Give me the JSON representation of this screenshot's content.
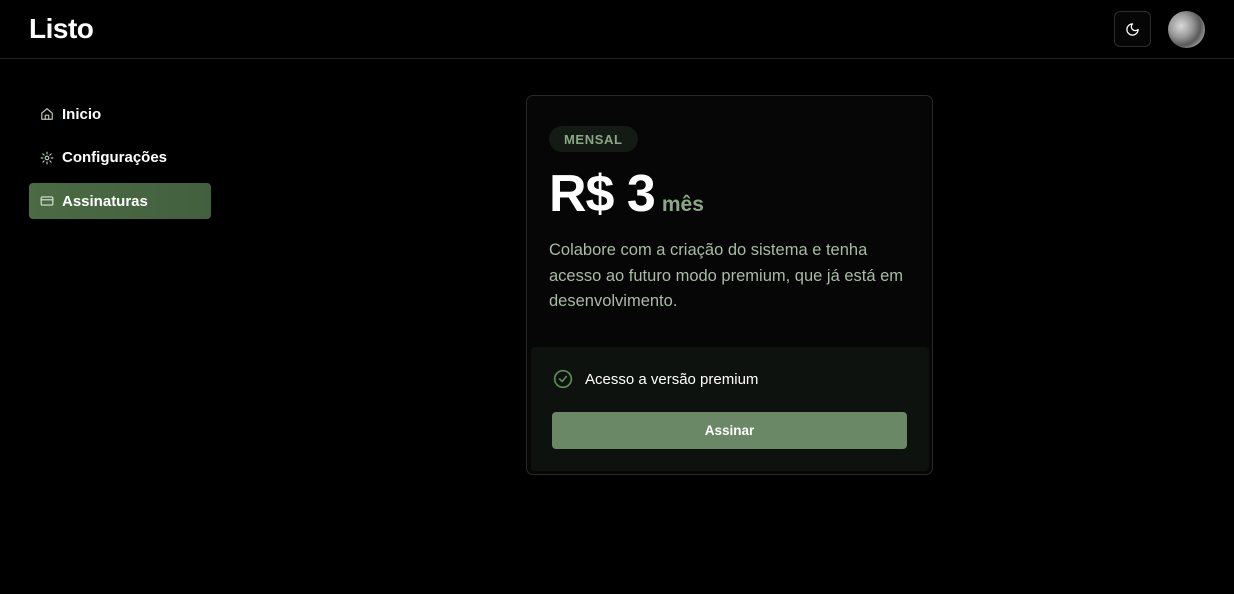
{
  "app": {
    "title": "Listo"
  },
  "header": {
    "theme_toggle_icon": "moon-icon",
    "avatar_icon": "user-avatar"
  },
  "sidebar": {
    "items": [
      {
        "label": "Inicio",
        "icon": "home-icon",
        "active": false
      },
      {
        "label": "Configurações",
        "icon": "gear-icon",
        "active": false
      },
      {
        "label": "Assinaturas",
        "icon": "credit-card-icon",
        "active": true
      }
    ]
  },
  "plan": {
    "badge": "MENSAL",
    "price": "R$ 3",
    "period": "mês",
    "description": "Colabore com a criação do sistema e tenha acesso ao futuro modo premium, que já está em desenvolvimento.",
    "features": [
      {
        "label": "Acesso a versão premium",
        "icon": "check-circle-icon"
      }
    ],
    "cta_label": "Assinar"
  },
  "colors": {
    "background": "#000000",
    "accent": "#6a8865",
    "accent_active_nav": "#4a6b44",
    "muted_green_text": "#8aa886"
  }
}
